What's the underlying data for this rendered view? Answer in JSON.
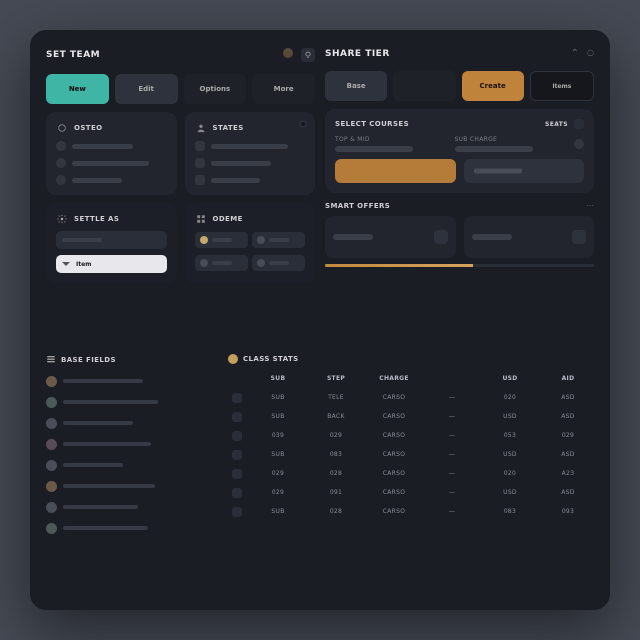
{
  "left": {
    "title": "SET TEAM",
    "buttons": [
      "New",
      "Edit",
      "Options",
      "More"
    ],
    "cards": {
      "a": {
        "title": "OSTEO",
        "items": 3
      },
      "b": {
        "title": "STATES",
        "items": 3
      },
      "c": {
        "title": "SETTLE AS",
        "active_label": "Item"
      },
      "d": {
        "title": "ODEME",
        "chips": 2
      }
    }
  },
  "right": {
    "title": "SHARE TIER",
    "buttons": [
      "Base",
      "",
      "Create",
      "Items"
    ],
    "section1": {
      "title": "SELECT COURSES",
      "head_r": "SEATS",
      "k1": "TOP & MID",
      "k2": "SUB CHARGE"
    },
    "section2": {
      "title": "SMART OFFERS"
    }
  },
  "table": {
    "left_title": "BASE FIELDS",
    "right_title": "CLASS STATS",
    "cols": [
      "",
      "SUB",
      "STEP",
      "CHARGE",
      "",
      "USD",
      "AID"
    ],
    "rows": 7
  }
}
